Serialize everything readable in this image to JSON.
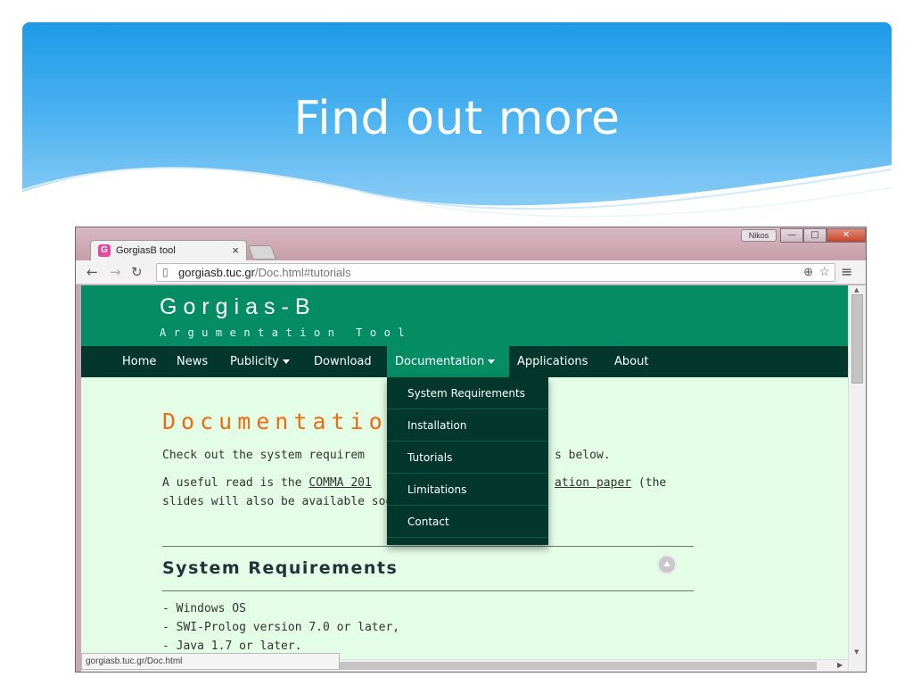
{
  "slide": {
    "title": "Find out more"
  },
  "browser": {
    "tab_title": "GorgiasB tool",
    "tab_close": "×",
    "favicon_letter": "G",
    "user": "Nikos",
    "window_buttons": {
      "minimize": "—",
      "maximize": "□",
      "close": "✕"
    },
    "url_host": "gorgiasb.tuc.gr",
    "url_path": "/Doc.html#tutorials",
    "status_url": "gorgiasb.tuc.gr/Doc.html"
  },
  "site": {
    "name": "Gorgias-B",
    "tagline": "Argumentation Tool",
    "nav": [
      {
        "label": "Home"
      },
      {
        "label": "News"
      },
      {
        "label": "Publicity"
      },
      {
        "label": "Download"
      },
      {
        "label": "Documentation"
      },
      {
        "label": "Applications"
      },
      {
        "label": "About"
      }
    ],
    "dropdown": [
      {
        "label": "System Requirements"
      },
      {
        "label": "Installation"
      },
      {
        "label": "Tutorials"
      },
      {
        "label": "Limitations"
      },
      {
        "label": "Contact"
      }
    ]
  },
  "content": {
    "heading": "Documentatio",
    "para1_start": "Check out the system requirem",
    "para1_end": "s below.",
    "para2_a": "A useful read is the ",
    "para2_link1": "COMMA 201",
    "para2_link2": "ation paper",
    "para2_b": " (the",
    "para2_line2": "slides will also be available soo",
    "section_heading": "System Requirements",
    "requirements": [
      "- Windows OS",
      "- SWI-Prolog version 7.0 or later,",
      "- Java 1.7 or later."
    ]
  },
  "colors": {
    "site_header": "#068c63",
    "navbar": "#04372b",
    "heading_orange": "#f06b0f",
    "page_bg": "#e4fde6"
  }
}
